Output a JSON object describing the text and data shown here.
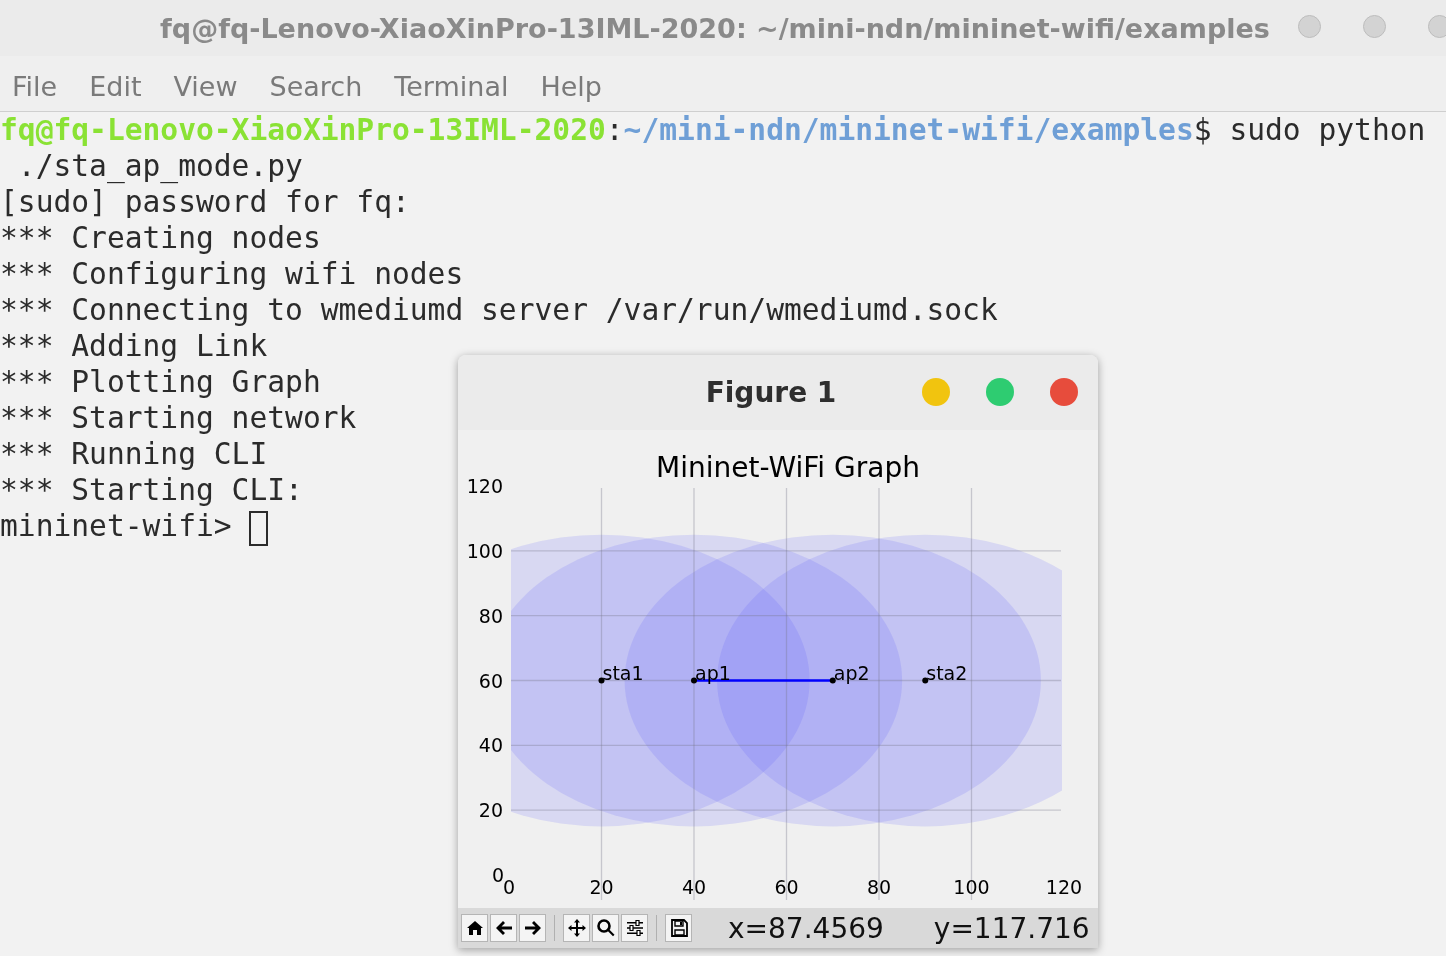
{
  "window": {
    "title": "fq@fq-Lenovo-XiaoXinPro-13IML-2020: ~/mini-ndn/mininet-wifi/examples"
  },
  "menu": [
    "File",
    "Edit",
    "View",
    "Search",
    "Terminal",
    "Help"
  ],
  "terminal": {
    "lines": [
      [
        {
          "kind": "user",
          "text": "fq@fq-Lenovo-XiaoXinPro-13IML-2020"
        },
        {
          "kind": "plain",
          "text": ":"
        },
        {
          "kind": "path",
          "text": "~/mini-ndn/mininet-wifi/examples"
        },
        {
          "kind": "plain",
          "text": "$ sudo python"
        }
      ],
      [
        {
          "kind": "plain",
          "text": " ./sta_ap_mode.py"
        }
      ],
      [
        {
          "kind": "plain",
          "text": "[sudo] password for fq:"
        }
      ],
      [
        {
          "kind": "plain",
          "text": "*** Creating nodes"
        }
      ],
      [
        {
          "kind": "plain",
          "text": "*** Configuring wifi nodes"
        }
      ],
      [
        {
          "kind": "plain",
          "text": "*** Connecting to wmediumd server /var/run/wmediumd.sock"
        }
      ],
      [
        {
          "kind": "plain",
          "text": "*** Adding Link"
        }
      ],
      [
        {
          "kind": "plain",
          "text": "*** Plotting Graph"
        }
      ],
      [
        {
          "kind": "plain",
          "text": "*** Starting network"
        }
      ],
      [
        {
          "kind": "plain",
          "text": "*** Running CLI"
        }
      ],
      [
        {
          "kind": "plain",
          "text": "*** Starting CLI:"
        }
      ],
      [
        {
          "kind": "plain",
          "text": "mininet-wifi> "
        }
      ]
    ],
    "cursor": true
  },
  "figure": {
    "title": "Figure 1",
    "controls": [
      {
        "color": "#f1c40f"
      },
      {
        "color": "#2ecc71"
      },
      {
        "color": "#e74c3c"
      }
    ],
    "chart_data": {
      "type": "scatter",
      "title": "Mininet-WiFi Graph",
      "x": [
        20,
        40,
        70,
        90
      ],
      "series": [
        {
          "type": "scatter",
          "color": "#000000",
          "values": [
            60,
            60,
            60,
            60
          ]
        },
        {
          "type": "line",
          "color": "#0000ff",
          "values": [
            null,
            60,
            60,
            null
          ]
        }
      ],
      "grid": true,
      "xlim": [
        0,
        120
      ],
      "ylim": [
        0,
        120
      ],
      "xticks": [
        0,
        20,
        40,
        60,
        80,
        100,
        120
      ],
      "yticks": [
        0,
        20,
        40,
        60,
        80,
        100,
        120
      ],
      "annotations": [
        {
          "text": "sta1",
          "x": 20,
          "y": 60
        },
        {
          "text": "ap1",
          "x": 40,
          "y": 60
        },
        {
          "text": "ap2",
          "x": 70,
          "y": 60
        },
        {
          "text": "sta2",
          "x": 90,
          "y": 60
        }
      ]
    },
    "toolbar": [
      [
        {
          "kind": "home"
        },
        {
          "kind": "back"
        },
        {
          "kind": "forward"
        }
      ],
      [
        {
          "kind": "pan"
        },
        {
          "kind": "zoom"
        },
        {
          "kind": "configure"
        }
      ],
      [
        {
          "kind": "save"
        }
      ]
    ],
    "coords": [
      "x=87.4569",
      "y=117.716"
    ]
  }
}
